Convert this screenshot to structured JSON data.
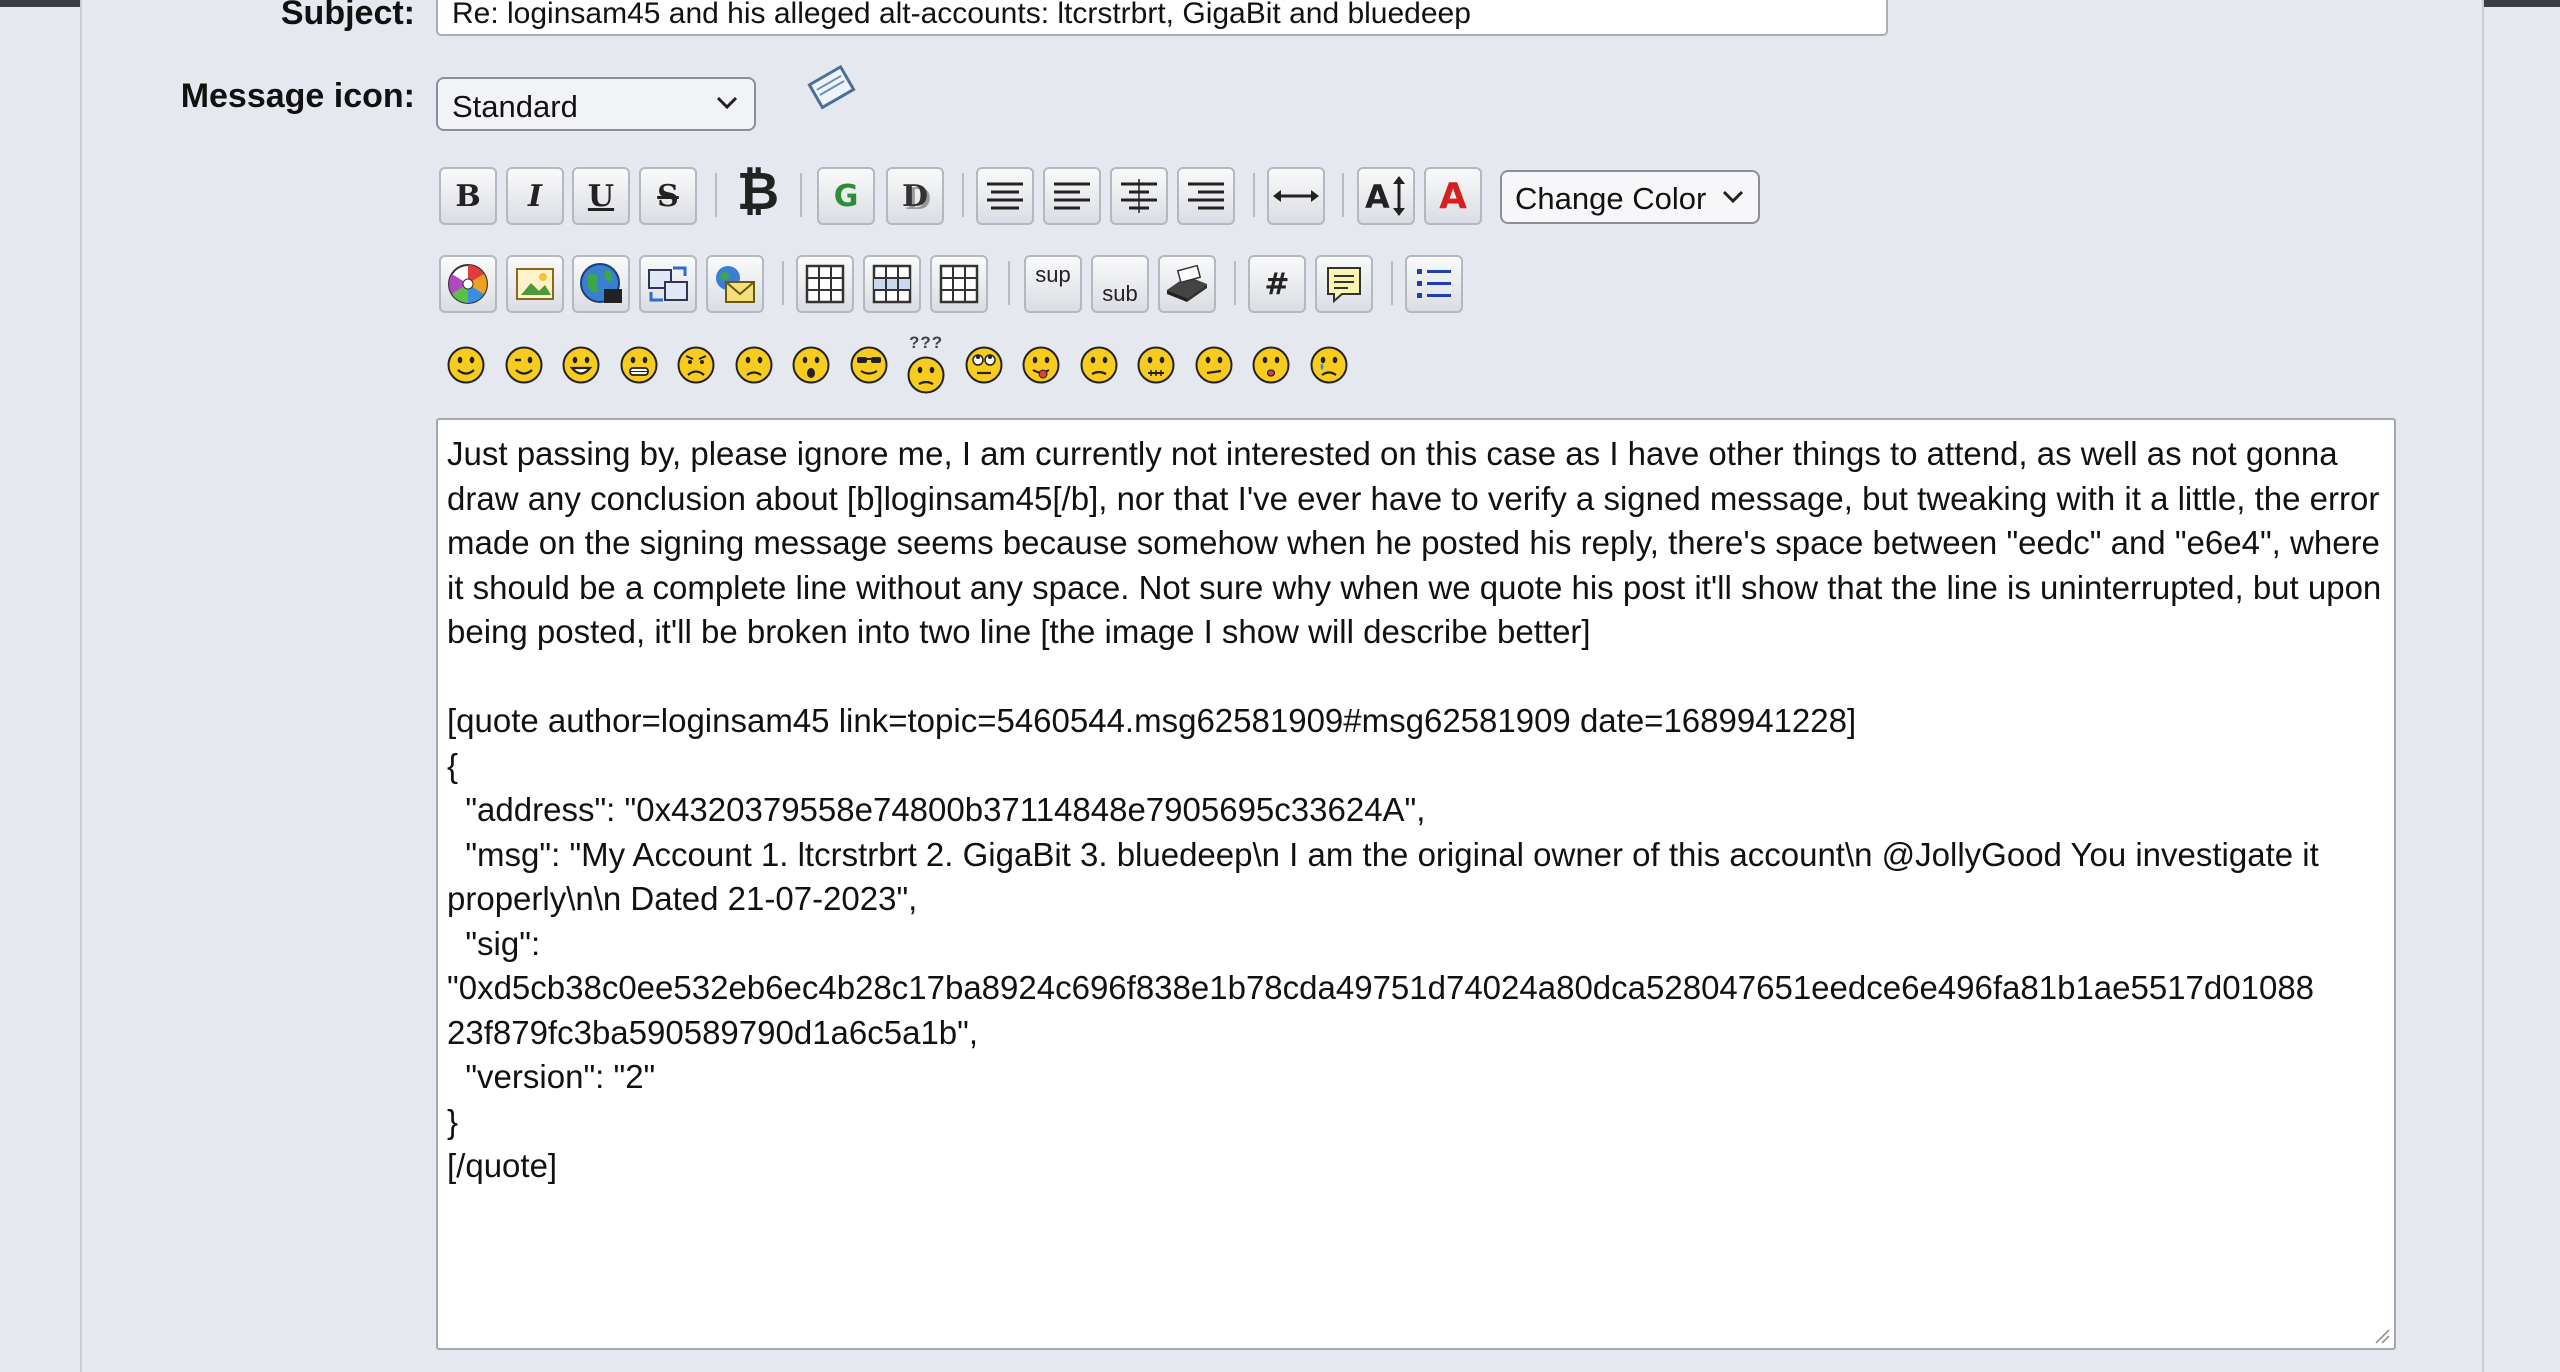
{
  "form": {
    "subject_label": "Subject:",
    "subject_value": "Re: loginsam45 and his alleged alt-accounts: ltcrstrbrt, GigaBit and bluedeep",
    "message_icon_label": "Message icon:",
    "message_icon_selected": "Standard"
  },
  "toolbar": {
    "change_color_label": "Change Color",
    "row1": [
      "bold",
      "italic",
      "underline",
      "strikethrough",
      "bitcoin",
      "glow",
      "shadow",
      "preformatted",
      "left-align",
      "center",
      "right-align",
      "horizontal-rule",
      "font-size",
      "font-face"
    ],
    "row2": [
      "flash",
      "image",
      "hyperlink",
      "ftp",
      "email",
      "table",
      "table-row",
      "table-column",
      "superscript",
      "subscript",
      "teletype",
      "code",
      "quote",
      "list"
    ],
    "sup_label": "sup",
    "sub_label": "sub",
    "code_label": "#"
  },
  "smileys": [
    "smiley",
    "wink",
    "cheesy",
    "grin",
    "angry",
    "sad",
    "shocked",
    "cool",
    "huh",
    "rolleyes",
    "tongue",
    "embarrassed",
    "lips-sealed",
    "undecided",
    "kiss",
    "cry"
  ],
  "smiley_huh_label": "???",
  "message_body": "Just passing by, please ignore me, I am currently not interested on this case as I have other things to attend, as well as not gonna draw any conclusion about [b]loginsam45[/b], nor that I've ever have to verify a signed message, but tweaking with it a little, the error made on the signing message seems because somehow when he posted his reply, there's space between \"eedc\" and \"e6e4\", where it should be a complete line without any space. Not sure why when we quote his post it'll show that the line is uninterrupted, but upon being posted, it'll be broken into two line [the image I show will describe better]\n\n[quote author=loginsam45 link=topic=5460544.msg62581909#msg62581909 date=1689941228]\n{\n  \"address\": \"0x4320379558e74800b37114848e7905695c33624A\",\n  \"msg\": \"My Account 1. ltcrstrbrt 2. GigaBit 3. bluedeep\\n I am the original owner of this account\\n @JollyGood You investigate it properly\\n\\n Dated 21-07-2023\",\n  \"sig\":\n\"0xd5cb38c0ee532eb6ec4b28c17ba8924c696f838e1b78cda49751d74024a80dca528047651eedce6e496fa81b1ae5517d01088 23f879fc3ba590589790d1a6c5a1b\",\n  \"version\": \"2\"\n}\n[/quote]"
}
